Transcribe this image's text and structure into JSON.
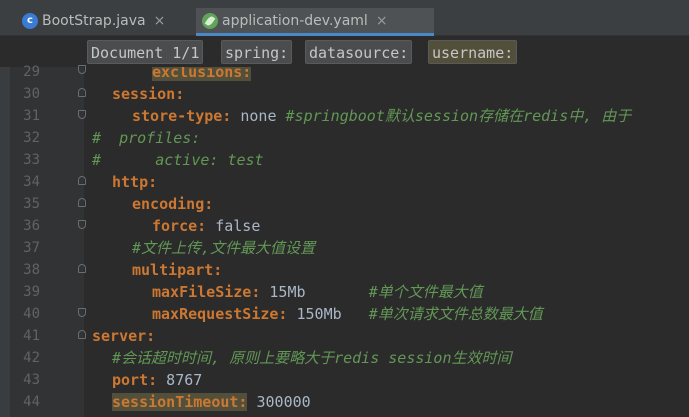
{
  "tabs": [
    {
      "name": "BootStrap.java",
      "icon": "java-class-icon",
      "active": false
    },
    {
      "name": "application-dev.yaml",
      "icon": "spring-leaf-icon",
      "active": true
    }
  ],
  "tab_close": "×",
  "breadcrumbs": [
    "Document 1/1",
    "spring:",
    "datasource:",
    "username:"
  ],
  "line_numbers": [
    "29",
    "30",
    "31",
    "32",
    "33",
    "34",
    "35",
    "36",
    "37",
    "38",
    "39",
    "40",
    "41",
    "42",
    "43",
    "44"
  ],
  "code": {
    "l29": {
      "key": "exclusions:"
    },
    "l30": {
      "key": "session:"
    },
    "l31": {
      "key": "store-type:",
      "value": " none ",
      "comment": "#springboot默认session存储在redis中, 由于"
    },
    "l32": {
      "comment": "#  profiles:"
    },
    "l33": {
      "comment": "#      active: test"
    },
    "l34": {
      "key": "http:"
    },
    "l35": {
      "key": "encoding:"
    },
    "l36": {
      "key": "force:",
      "value": " false"
    },
    "l37": {
      "comment": "#文件上传,文件最大值设置"
    },
    "l38": {
      "key": "multipart:"
    },
    "l39": {
      "key": "maxFileSize:",
      "value": " 15Mb       ",
      "comment": "#单个文件最大值"
    },
    "l40": {
      "key": "maxRequestSize:",
      "value": " 150Mb   ",
      "comment": "#单次请求文件总数最大值"
    },
    "l41": {
      "key": "server:"
    },
    "l42": {
      "comment": "#会话超时时间, 原则上要略大于redis session生效时间"
    },
    "l43": {
      "key": "port:",
      "value": " 8767"
    },
    "l44": {
      "key": "sessionTimeout:",
      "value": " 300000"
    }
  },
  "colors": {
    "keyword": "#cc7832",
    "comment": "#629755",
    "text": "#a9b7c6",
    "accent": "#4a88c7",
    "highlight": "#52503a"
  }
}
